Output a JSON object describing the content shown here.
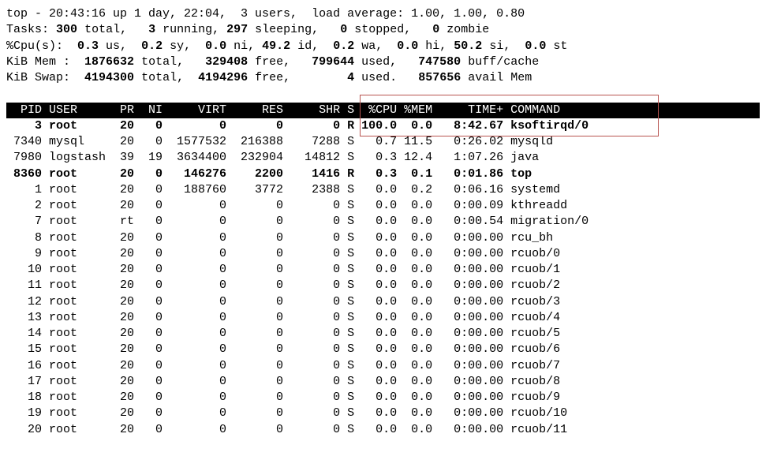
{
  "summary": {
    "line1": "top - 20:43:16 up 1 day, 22:04,  3 users,  load average: 1.00, 1.00, 0.80",
    "line2": "Tasks: 300 total,   3 running, 297 sleeping,   0 stopped,   0 zombie",
    "line3": "%Cpu(s):  0.3 us,  0.2 sy,  0.0 ni, 49.2 id,  0.2 wa,  0.0 hi, 50.2 si,  0.0 st",
    "line4": "KiB Mem :  1876632 total,   329408 free,   799644 used,   747580 buff/cache",
    "line5": "KiB Swap:  4194300 total,  4194296 free,        4 used.   857656 avail Mem"
  },
  "columns": [
    "PID",
    "USER",
    "PR",
    "NI",
    "VIRT",
    "RES",
    "SHR",
    "S",
    "%CPU",
    "%MEM",
    "TIME+",
    "COMMAND"
  ],
  "col_widths": {
    "PID": 5,
    "USER": 9,
    "PR": 3,
    "NI": 3,
    "VIRT": 8,
    "RES": 7,
    "SHR": 7,
    "S": 1,
    "%CPU": 5,
    "%MEM": 4,
    "TIME+": 9,
    "COMMAND": 20
  },
  "highlight_row_pid": 3,
  "bold_rows": [
    3,
    8360
  ],
  "processes": [
    {
      "pid": 3,
      "user": "root",
      "pr": "20",
      "ni": "0",
      "virt": "0",
      "res": "0",
      "shr": "0",
      "s": "R",
      "cpu": "100.0",
      "mem": "0.0",
      "time": "8:42.67",
      "cmd": "ksoftirqd/0"
    },
    {
      "pid": 7340,
      "user": "mysql",
      "pr": "20",
      "ni": "0",
      "virt": "1577532",
      "res": "216388",
      "shr": "7288",
      "s": "S",
      "cpu": "0.7",
      "mem": "11.5",
      "time": "0:26.02",
      "cmd": "mysqld"
    },
    {
      "pid": 7980,
      "user": "logstash",
      "pr": "39",
      "ni": "19",
      "virt": "3634400",
      "res": "232904",
      "shr": "14812",
      "s": "S",
      "cpu": "0.3",
      "mem": "12.4",
      "time": "1:07.26",
      "cmd": "java"
    },
    {
      "pid": 8360,
      "user": "root",
      "pr": "20",
      "ni": "0",
      "virt": "146276",
      "res": "2200",
      "shr": "1416",
      "s": "R",
      "cpu": "0.3",
      "mem": "0.1",
      "time": "0:01.86",
      "cmd": "top"
    },
    {
      "pid": 1,
      "user": "root",
      "pr": "20",
      "ni": "0",
      "virt": "188760",
      "res": "3772",
      "shr": "2388",
      "s": "S",
      "cpu": "0.0",
      "mem": "0.2",
      "time": "0:06.16",
      "cmd": "systemd"
    },
    {
      "pid": 2,
      "user": "root",
      "pr": "20",
      "ni": "0",
      "virt": "0",
      "res": "0",
      "shr": "0",
      "s": "S",
      "cpu": "0.0",
      "mem": "0.0",
      "time": "0:00.09",
      "cmd": "kthreadd"
    },
    {
      "pid": 7,
      "user": "root",
      "pr": "rt",
      "ni": "0",
      "virt": "0",
      "res": "0",
      "shr": "0",
      "s": "S",
      "cpu": "0.0",
      "mem": "0.0",
      "time": "0:00.54",
      "cmd": "migration/0"
    },
    {
      "pid": 8,
      "user": "root",
      "pr": "20",
      "ni": "0",
      "virt": "0",
      "res": "0",
      "shr": "0",
      "s": "S",
      "cpu": "0.0",
      "mem": "0.0",
      "time": "0:00.00",
      "cmd": "rcu_bh"
    },
    {
      "pid": 9,
      "user": "root",
      "pr": "20",
      "ni": "0",
      "virt": "0",
      "res": "0",
      "shr": "0",
      "s": "S",
      "cpu": "0.0",
      "mem": "0.0",
      "time": "0:00.00",
      "cmd": "rcuob/0"
    },
    {
      "pid": 10,
      "user": "root",
      "pr": "20",
      "ni": "0",
      "virt": "0",
      "res": "0",
      "shr": "0",
      "s": "S",
      "cpu": "0.0",
      "mem": "0.0",
      "time": "0:00.00",
      "cmd": "rcuob/1"
    },
    {
      "pid": 11,
      "user": "root",
      "pr": "20",
      "ni": "0",
      "virt": "0",
      "res": "0",
      "shr": "0",
      "s": "S",
      "cpu": "0.0",
      "mem": "0.0",
      "time": "0:00.00",
      "cmd": "rcuob/2"
    },
    {
      "pid": 12,
      "user": "root",
      "pr": "20",
      "ni": "0",
      "virt": "0",
      "res": "0",
      "shr": "0",
      "s": "S",
      "cpu": "0.0",
      "mem": "0.0",
      "time": "0:00.00",
      "cmd": "rcuob/3"
    },
    {
      "pid": 13,
      "user": "root",
      "pr": "20",
      "ni": "0",
      "virt": "0",
      "res": "0",
      "shr": "0",
      "s": "S",
      "cpu": "0.0",
      "mem": "0.0",
      "time": "0:00.00",
      "cmd": "rcuob/4"
    },
    {
      "pid": 14,
      "user": "root",
      "pr": "20",
      "ni": "0",
      "virt": "0",
      "res": "0",
      "shr": "0",
      "s": "S",
      "cpu": "0.0",
      "mem": "0.0",
      "time": "0:00.00",
      "cmd": "rcuob/5"
    },
    {
      "pid": 15,
      "user": "root",
      "pr": "20",
      "ni": "0",
      "virt": "0",
      "res": "0",
      "shr": "0",
      "s": "S",
      "cpu": "0.0",
      "mem": "0.0",
      "time": "0:00.00",
      "cmd": "rcuob/6"
    },
    {
      "pid": 16,
      "user": "root",
      "pr": "20",
      "ni": "0",
      "virt": "0",
      "res": "0",
      "shr": "0",
      "s": "S",
      "cpu": "0.0",
      "mem": "0.0",
      "time": "0:00.00",
      "cmd": "rcuob/7"
    },
    {
      "pid": 17,
      "user": "root",
      "pr": "20",
      "ni": "0",
      "virt": "0",
      "res": "0",
      "shr": "0",
      "s": "S",
      "cpu": "0.0",
      "mem": "0.0",
      "time": "0:00.00",
      "cmd": "rcuob/8"
    },
    {
      "pid": 18,
      "user": "root",
      "pr": "20",
      "ni": "0",
      "virt": "0",
      "res": "0",
      "shr": "0",
      "s": "S",
      "cpu": "0.0",
      "mem": "0.0",
      "time": "0:00.00",
      "cmd": "rcuob/9"
    },
    {
      "pid": 19,
      "user": "root",
      "pr": "20",
      "ni": "0",
      "virt": "0",
      "res": "0",
      "shr": "0",
      "s": "S",
      "cpu": "0.0",
      "mem": "0.0",
      "time": "0:00.00",
      "cmd": "rcuob/10"
    },
    {
      "pid": 20,
      "user": "root",
      "pr": "20",
      "ni": "0",
      "virt": "0",
      "res": "0",
      "shr": "0",
      "s": "S",
      "cpu": "0.0",
      "mem": "0.0",
      "time": "0:00.00",
      "cmd": "rcuob/11"
    }
  ]
}
